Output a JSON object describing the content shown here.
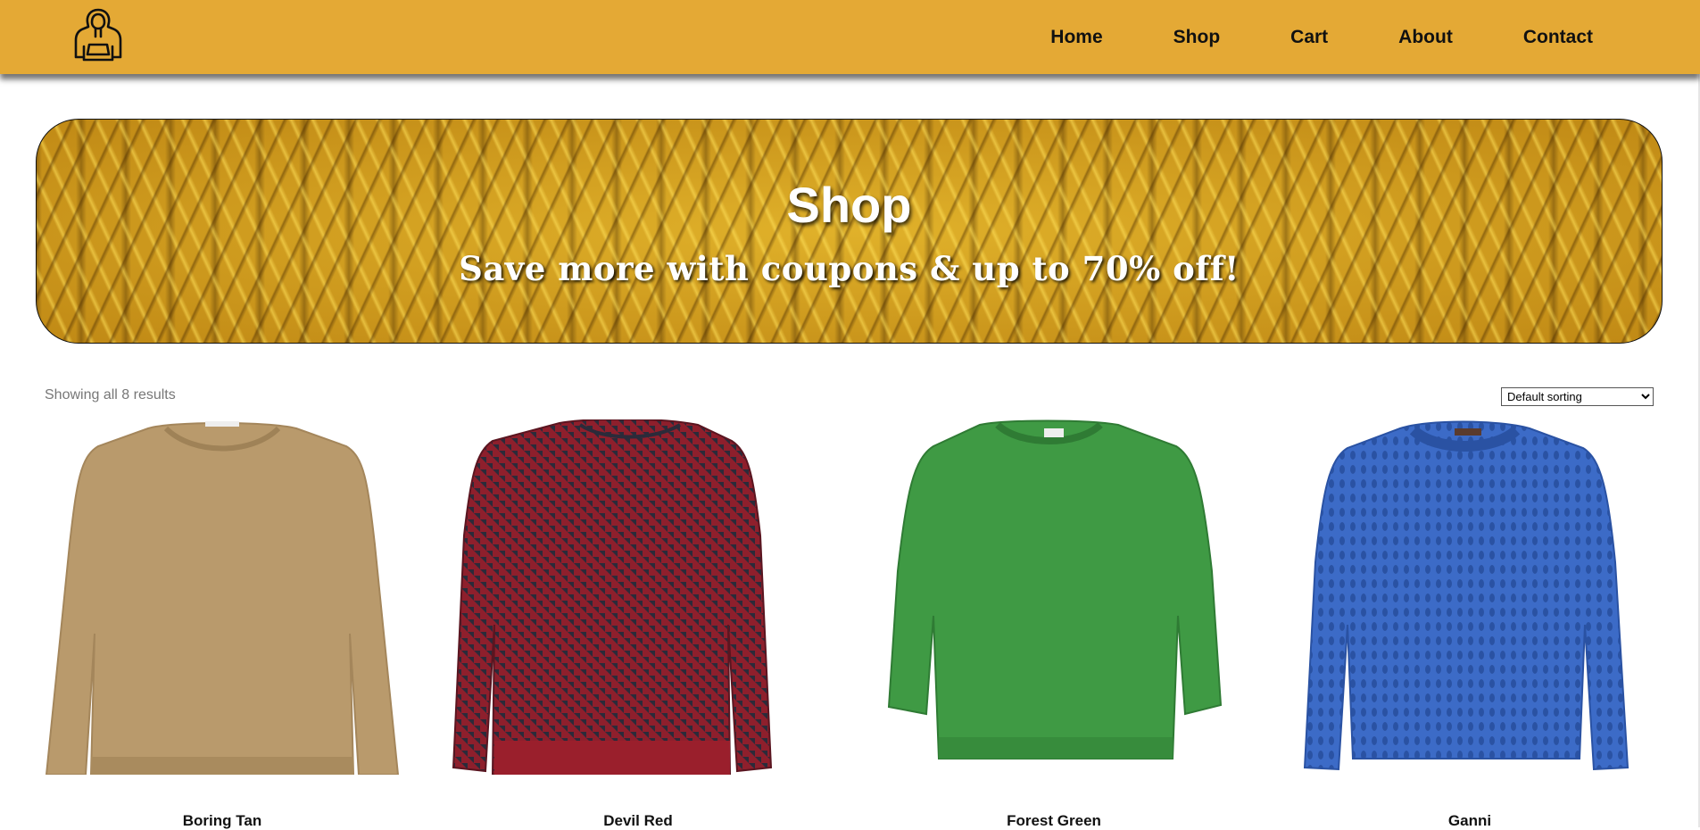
{
  "nav": {
    "logo_icon": "hoodie-icon",
    "items": [
      "Home",
      "Shop",
      "Cart",
      "About",
      "Contact"
    ]
  },
  "hero": {
    "title": "Shop",
    "subtitle": "Save more with coupons & up to 70% off!"
  },
  "shop": {
    "result_count": "Showing all 8 results",
    "sort_selected": "Default sorting"
  },
  "products": [
    {
      "name": "Boring Tan",
      "color": "#b99a6c"
    },
    {
      "name": "Devil Red",
      "color": "#8e1f2c"
    },
    {
      "name": "Forest Green",
      "color": "#3f9a44"
    },
    {
      "name": "Ganni",
      "color": "#3c6bc7"
    }
  ],
  "colors": {
    "header_bg": "#e4a935",
    "hero_bg": "#c99a1c"
  }
}
